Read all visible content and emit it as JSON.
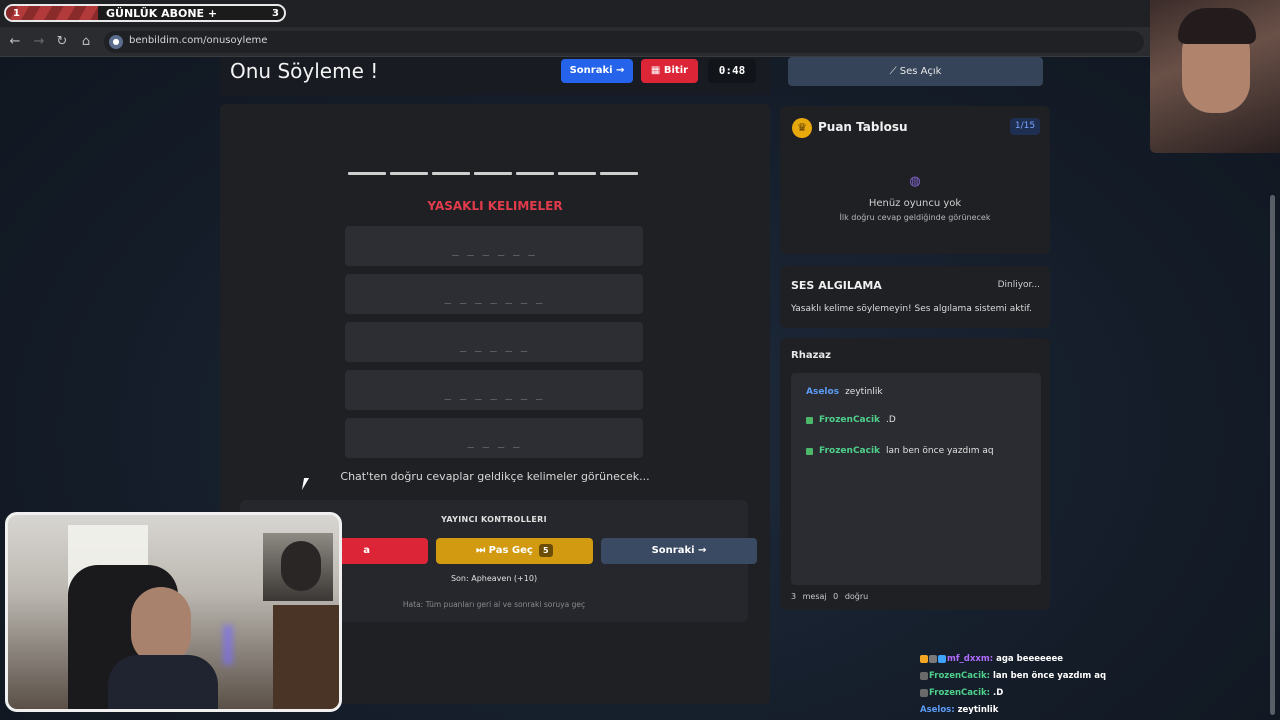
{
  "browser": {
    "sub_goal": {
      "start": "1",
      "title": "GÜNLÜK ABONE",
      "plus": "+",
      "end": "3",
      "progress": 0.33
    },
    "url": "benbildim.com/onusoyleme"
  },
  "header": {
    "title": "Onu Söyleme !",
    "next_label": "Sonraki →",
    "finish_label": "Bitir",
    "timer": "0:48"
  },
  "game": {
    "slot_count": 7,
    "forbidden_title": "YASAKLI KELIMELER",
    "forbidden_words": [
      "_ _ _ _ _ _",
      "_ _ _ _ _ _ _",
      "_ _ _ _ _",
      "_ _ _ _ _ _ _",
      "_ _ _ _"
    ],
    "hint": "Chat'ten doğru cevaplar geldikçe kelimeler görünecek..."
  },
  "controls": {
    "title": "YAYINCI KONTROLLERI",
    "reset_label": "a",
    "skip_label": "Pas Geç",
    "skip_count": "5",
    "next_label": "Sonraki →",
    "last": "Son: Apheaven (+10)",
    "reset_hint": "Hata: Tüm puanları geri al ve sonraki soruya geç"
  },
  "sidebar": {
    "sound_label": "Ses Açık",
    "score": {
      "title": "Puan Tablosu",
      "round": "1/15",
      "empty": "Henüz oyuncu yok",
      "empty_sub": "İlk doğru cevap geldiğinde görünecek"
    },
    "voice": {
      "title": "SES ALGILAMA",
      "status": "Dinliyor...",
      "desc": "Yasaklı kelime söylemeyin! Ses algılama sistemi aktif."
    },
    "chat": {
      "owner": "Rhazaz",
      "messages": [
        {
          "user": "Aselos",
          "text": "zeytinlik",
          "check": false
        },
        {
          "user": "FrozenCacik",
          "text": ".D",
          "check": true
        },
        {
          "user": "FrozenCacik",
          "text": "lan ben önce yazdım aq",
          "check": true
        }
      ],
      "stats": "3 mesaj 0 doğru"
    }
  },
  "stream_chat": [
    {
      "user": "mf_dxxm:",
      "text": "aga beeeeeee",
      "color": "#b06cff"
    },
    {
      "user": "FrozenCacik:",
      "text": "lan ben önce yazdım aq",
      "color": "#4fd08a"
    },
    {
      "user": "FrozenCacik:",
      "text": ".D",
      "color": "#4fd08a"
    },
    {
      "user": "Aselos:",
      "text": "zeytinlik",
      "color": "#5c9bf5"
    }
  ],
  "colors": {
    "accent_blue": "#2563eb",
    "danger_red": "#dc2637",
    "warning_gold": "#d19a10",
    "forbidden_red": "#e23b4b"
  }
}
